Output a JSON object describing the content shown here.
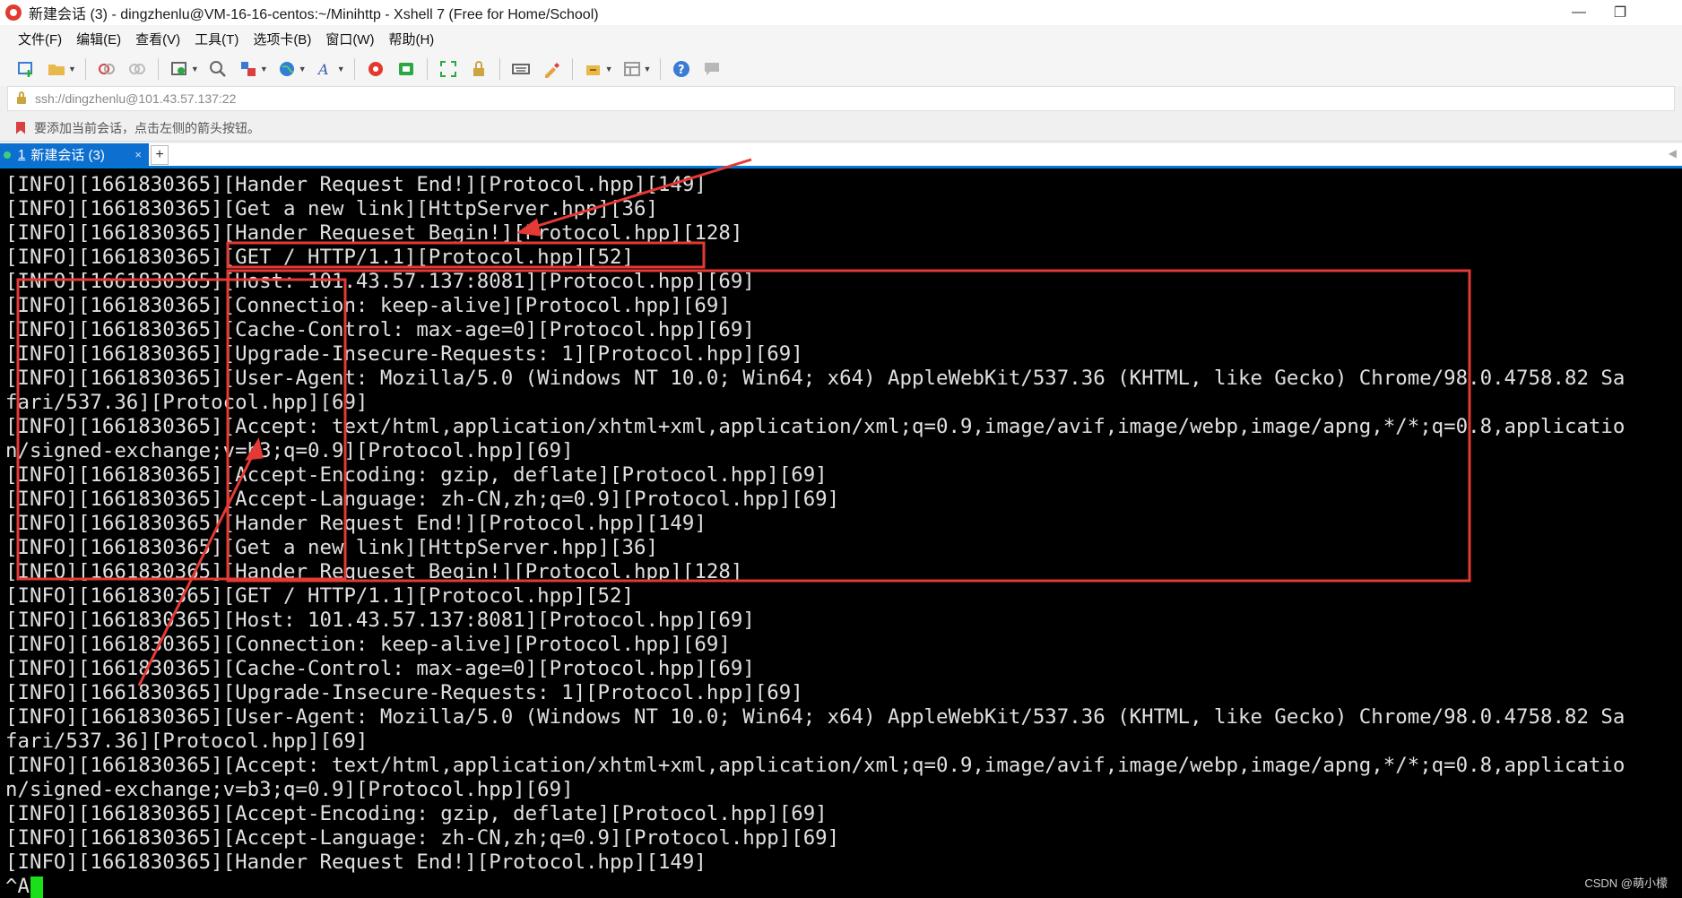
{
  "window": {
    "title": "新建会话 (3) - dingzhenlu@VM-16-16-centos:~/Minihttp - Xshell 7 (Free for Home/School)",
    "minimize_glyph": "—",
    "maximize_glyph": "❐"
  },
  "menu": [
    "文件(F)",
    "编辑(E)",
    "查看(V)",
    "工具(T)",
    "选项卡(B)",
    "窗口(W)",
    "帮助(H)"
  ],
  "address": {
    "text": "ssh://dingzhenlu@101.43.57.137:22"
  },
  "hint": {
    "text": "要添加当前会话，点击左侧的箭头按钮。"
  },
  "tab": {
    "number": "1",
    "label": "新建会话 (3)",
    "close": "×",
    "add": "+"
  },
  "terminal": {
    "lines": [
      "[INFO][1661830365][Hander Request End!][Protocol.hpp][149]",
      "[INFO][1661830365][Get a new link][HttpServer.hpp][36]",
      "[INFO][1661830365][Hander Requeset Begin!][Protocol.hpp][128]",
      "[INFO][1661830365][GET / HTTP/1.1][Protocol.hpp][52]",
      "[INFO][1661830365][Host: 101.43.57.137:8081][Protocol.hpp][69]",
      "[INFO][1661830365][Connection: keep-alive][Protocol.hpp][69]",
      "[INFO][1661830365][Cache-Control: max-age=0][Protocol.hpp][69]",
      "[INFO][1661830365][Upgrade-Insecure-Requests: 1][Protocol.hpp][69]",
      "[INFO][1661830365][User-Agent: Mozilla/5.0 (Windows NT 10.0; Win64; x64) AppleWebKit/537.36 (KHTML, like Gecko) Chrome/98.0.4758.82 Sa",
      "fari/537.36][Protocol.hpp][69]",
      "[INFO][1661830365][Accept: text/html,application/xhtml+xml,application/xml;q=0.9,image/avif,image/webp,image/apng,*/*;q=0.8,applicatio",
      "n/signed-exchange;v=b3;q=0.9][Protocol.hpp][69]",
      "[INFO][1661830365][Accept-Encoding: gzip, deflate][Protocol.hpp][69]",
      "[INFO][1661830365][Accept-Language: zh-CN,zh;q=0.9][Protocol.hpp][69]",
      "[INFO][1661830365][Hander Request End!][Protocol.hpp][149]",
      "[INFO][1661830365][Get a new link][HttpServer.hpp][36]",
      "[INFO][1661830365][Hander Requeset Begin!][Protocol.hpp][128]",
      "[INFO][1661830365][GET / HTTP/1.1][Protocol.hpp][52]",
      "[INFO][1661830365][Host: 101.43.57.137:8081][Protocol.hpp][69]",
      "[INFO][1661830365][Connection: keep-alive][Protocol.hpp][69]",
      "[INFO][1661830365][Cache-Control: max-age=0][Protocol.hpp][69]",
      "[INFO][1661830365][Upgrade-Insecure-Requests: 1][Protocol.hpp][69]",
      "[INFO][1661830365][User-Agent: Mozilla/5.0 (Windows NT 10.0; Win64; x64) AppleWebKit/537.36 (KHTML, like Gecko) Chrome/98.0.4758.82 Sa",
      "fari/537.36][Protocol.hpp][69]",
      "[INFO][1661830365][Accept: text/html,application/xhtml+xml,application/xml;q=0.9,image/avif,image/webp,image/apng,*/*;q=0.8,applicatio",
      "n/signed-exchange;v=b3;q=0.9][Protocol.hpp][69]",
      "[INFO][1661830365][Accept-Encoding: gzip, deflate][Protocol.hpp][69]",
      "[INFO][1661830365][Accept-Language: zh-CN,zh;q=0.9][Protocol.hpp][69]",
      "[INFO][1661830365][Hander Request End!][Protocol.hpp][149]"
    ],
    "prompt": "^A"
  },
  "watermark": "CSDN @萌小檬",
  "colors": {
    "accent": "#0d6fd0",
    "annotation": "#e53935",
    "cursor": "#19e019"
  }
}
